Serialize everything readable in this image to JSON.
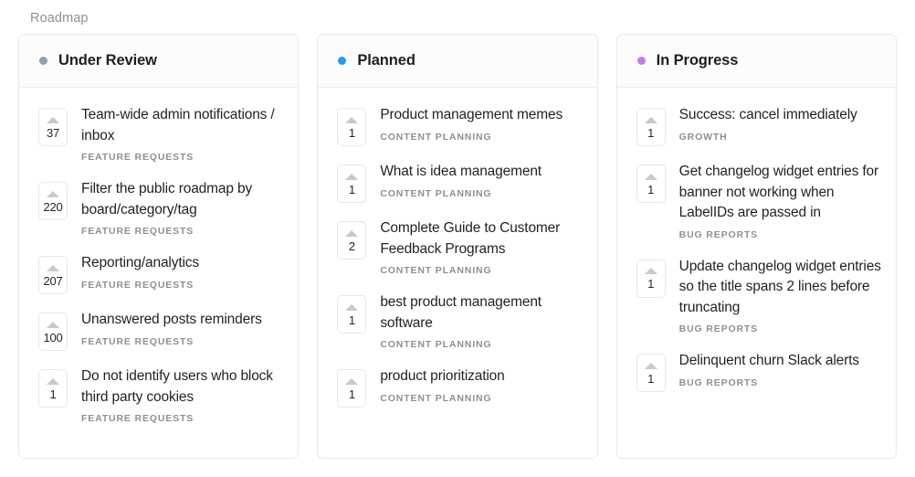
{
  "page": {
    "title": "Roadmap"
  },
  "colors": {
    "under_review_dot": "#8fa0b3",
    "planned_dot": "#209cf5",
    "in_progress_dot": "#c07ef5",
    "card_border": "#e8e9ea",
    "header_bg": "#fcfcfd",
    "title_text": "#8d9196"
  },
  "columns": [
    {
      "id": "under-review",
      "title": "Under Review",
      "dot_color": "#8fa0b3",
      "posts": [
        {
          "votes": "37",
          "title": "Team-wide admin notifications / inbox",
          "category": "Feature Requests"
        },
        {
          "votes": "220",
          "title": "Filter the public roadmap by board/category/tag",
          "category": "Feature Requests"
        },
        {
          "votes": "207",
          "title": "Reporting/analytics",
          "category": "Feature Requests"
        },
        {
          "votes": "100",
          "title": "Unanswered posts reminders",
          "category": "Feature Requests"
        },
        {
          "votes": "1",
          "title": "Do not identify users who block third party cookies",
          "category": "Feature Requests"
        }
      ]
    },
    {
      "id": "planned",
      "title": "Planned",
      "dot_color": "#209cf5",
      "posts": [
        {
          "votes": "1",
          "title": "Product management memes",
          "category": "Content Planning"
        },
        {
          "votes": "1",
          "title": "What is idea management",
          "category": "Content Planning"
        },
        {
          "votes": "2",
          "title": "Complete Guide to Customer Feedback Programs",
          "category": "Content Planning"
        },
        {
          "votes": "1",
          "title": "best product management software",
          "category": "Content Planning"
        },
        {
          "votes": "1",
          "title": "product prioritization",
          "category": "Content Planning"
        }
      ]
    },
    {
      "id": "in-progress",
      "title": "In Progress",
      "dot_color": "#c07ef5",
      "posts": [
        {
          "votes": "1",
          "title": "Success: cancel immediately",
          "category": "Growth"
        },
        {
          "votes": "1",
          "title": "Get changelog widget entries for banner not working when LabelIDs are passed in",
          "category": "Bug Reports"
        },
        {
          "votes": "1",
          "title": "Update changelog widget entries so the title spans 2 lines before truncating",
          "category": "Bug Reports"
        },
        {
          "votes": "1",
          "title": "Delinquent churn Slack alerts",
          "category": "Bug Reports"
        }
      ]
    }
  ]
}
